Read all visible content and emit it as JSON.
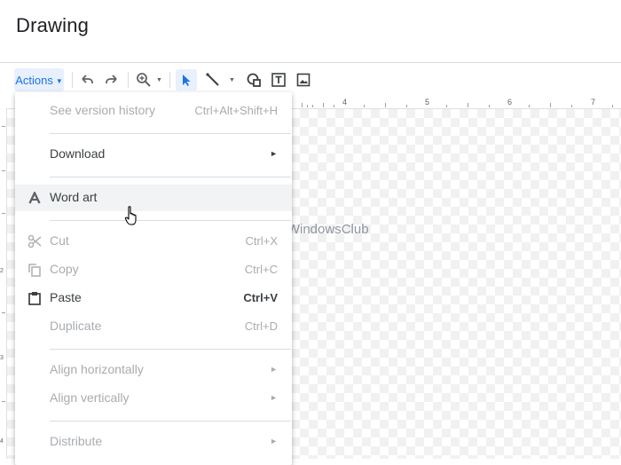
{
  "app": {
    "title": "Drawing"
  },
  "toolbar": {
    "actions_label": "Actions",
    "icons": [
      "undo-icon",
      "redo-icon",
      "zoom-icon",
      "select-icon",
      "line-icon",
      "shape-icon",
      "textbox-icon",
      "image-icon"
    ]
  },
  "ruler": {
    "top_labels": [
      "4",
      "5",
      "6",
      "7"
    ],
    "left_labels": [
      "2",
      "3",
      "4"
    ]
  },
  "watermark": {
    "text": "TheWindowsClub"
  },
  "menu": {
    "items": [
      {
        "label": "See version history",
        "shortcut": "Ctrl+Alt+Shift+H",
        "enabled": false
      },
      {
        "label": "Download",
        "submenu": true,
        "enabled": true
      },
      {
        "label": "Word art",
        "icon": "word-art-icon",
        "enabled": true,
        "hovered": true
      },
      {
        "label": "Cut",
        "shortcut": "Ctrl+X",
        "icon": "scissors-icon",
        "enabled": false
      },
      {
        "label": "Copy",
        "shortcut": "Ctrl+C",
        "icon": "copy-icon",
        "enabled": false
      },
      {
        "label": "Paste",
        "shortcut": "Ctrl+V",
        "icon": "paste-icon",
        "enabled": true
      },
      {
        "label": "Duplicate",
        "shortcut": "Ctrl+D",
        "enabled": false
      },
      {
        "label": "Align horizontally",
        "submenu": true,
        "enabled": false
      },
      {
        "label": "Align vertically",
        "submenu": true,
        "enabled": false
      },
      {
        "label": "Distribute",
        "submenu": true,
        "enabled": false
      }
    ]
  },
  "colors": {
    "accent": "#1a73e8",
    "accent_bg": "#e8f0fe",
    "disabled_text": "#a8acb0",
    "text": "#3c4043"
  }
}
